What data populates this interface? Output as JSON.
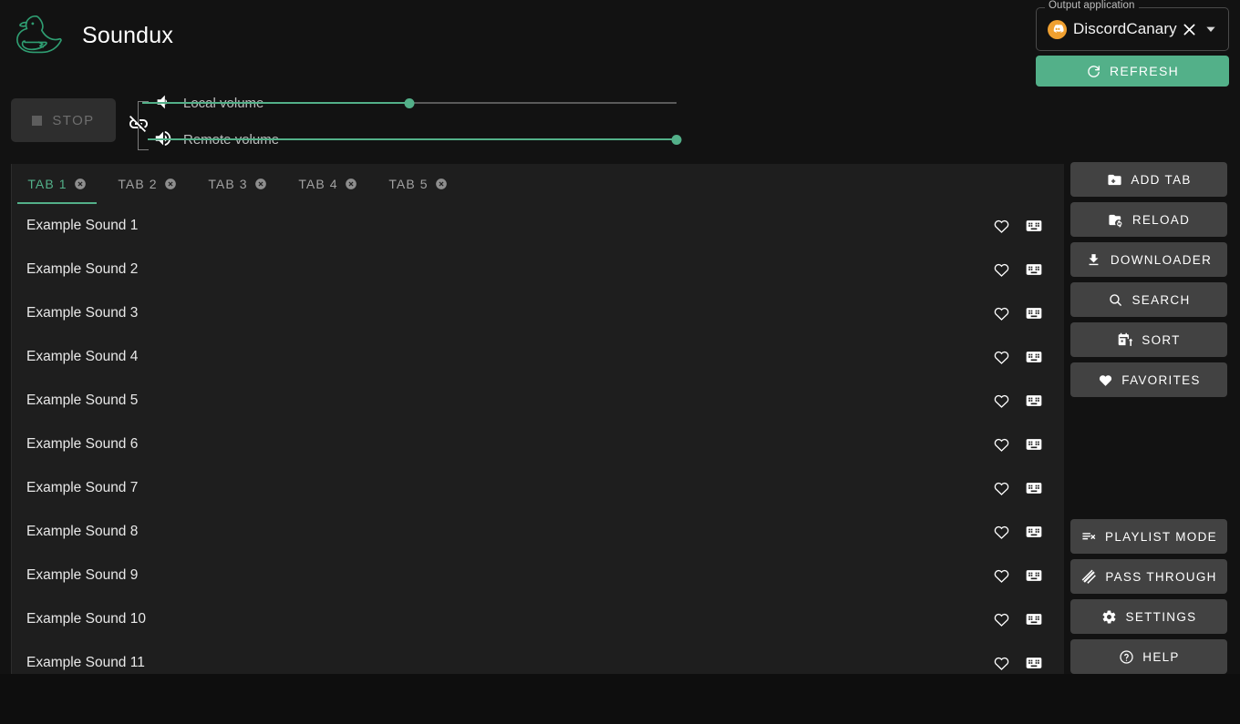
{
  "app": {
    "title": "Soundux",
    "logo_icon": "duck-logo-icon",
    "accent_color": "#53b089",
    "panel_color": "#1e1e1e",
    "background_color": "#121212"
  },
  "output": {
    "legend": "Output application",
    "value": "DiscordCanary",
    "app_icon": "discord-icon",
    "app_icon_color": "#f0a030",
    "clear_icon": "close-icon",
    "dropdown_icon": "chevron-down-icon",
    "refresh_label": "REFRESH",
    "refresh_icon": "refresh-icon"
  },
  "transport": {
    "stop_label": "STOP",
    "stop_icon": "stop-square-icon",
    "stop_disabled": true,
    "link_icon": "link-off-icon"
  },
  "volumes": [
    {
      "label": "Local volume",
      "icon": "volume-low-icon",
      "value": 50,
      "min": 0,
      "max": 100
    },
    {
      "label": "Remote volume",
      "icon": "volume-high-icon",
      "value": 100,
      "min": 0,
      "max": 100
    }
  ],
  "tabs": [
    {
      "label": "TAB 1",
      "active": true,
      "close_icon": "close-circle-icon"
    },
    {
      "label": "TAB 2",
      "active": false,
      "close_icon": "close-circle-icon"
    },
    {
      "label": "TAB 3",
      "active": false,
      "close_icon": "close-circle-icon"
    },
    {
      "label": "TAB 4",
      "active": false,
      "close_icon": "close-circle-icon"
    },
    {
      "label": "TAB 5",
      "active": false,
      "close_icon": "close-circle-icon"
    }
  ],
  "sounds": [
    {
      "name": "Example Sound 1",
      "favorite_icon": "heart-outline-icon",
      "hotkey_icon": "keyboard-icon"
    },
    {
      "name": "Example Sound 2",
      "favorite_icon": "heart-outline-icon",
      "hotkey_icon": "keyboard-icon"
    },
    {
      "name": "Example Sound 3",
      "favorite_icon": "heart-outline-icon",
      "hotkey_icon": "keyboard-icon"
    },
    {
      "name": "Example Sound 4",
      "favorite_icon": "heart-outline-icon",
      "hotkey_icon": "keyboard-icon"
    },
    {
      "name": "Example Sound 5",
      "favorite_icon": "heart-outline-icon",
      "hotkey_icon": "keyboard-icon"
    },
    {
      "name": "Example Sound 6",
      "favorite_icon": "heart-outline-icon",
      "hotkey_icon": "keyboard-icon"
    },
    {
      "name": "Example Sound 7",
      "favorite_icon": "heart-outline-icon",
      "hotkey_icon": "keyboard-icon"
    },
    {
      "name": "Example Sound 8",
      "favorite_icon": "heart-outline-icon",
      "hotkey_icon": "keyboard-icon"
    },
    {
      "name": "Example Sound 9",
      "favorite_icon": "heart-outline-icon",
      "hotkey_icon": "keyboard-icon"
    },
    {
      "name": "Example Sound 10",
      "favorite_icon": "heart-outline-icon",
      "hotkey_icon": "keyboard-icon"
    },
    {
      "name": "Example Sound 11",
      "favorite_icon": "heart-outline-icon",
      "hotkey_icon": "keyboard-icon"
    }
  ],
  "sidebar_top": [
    {
      "label": "ADD TAB",
      "icon": "folder-plus-icon"
    },
    {
      "label": "RELOAD",
      "icon": "folder-refresh-icon"
    },
    {
      "label": "DOWNLOADER",
      "icon": "download-icon"
    },
    {
      "label": "SEARCH",
      "icon": "search-icon"
    },
    {
      "label": "SORT",
      "icon": "sort-calendar-icon"
    },
    {
      "label": "FAVORITES",
      "icon": "heart-filled-icon"
    }
  ],
  "sidebar_bottom": [
    {
      "label": "PLAYLIST MODE",
      "icon": "playlist-remove-icon"
    },
    {
      "label": "PASS THROUGH",
      "icon": "layers-icon"
    },
    {
      "label": "SETTINGS",
      "icon": "gear-icon"
    },
    {
      "label": "HELP",
      "icon": "help-circle-icon"
    }
  ]
}
